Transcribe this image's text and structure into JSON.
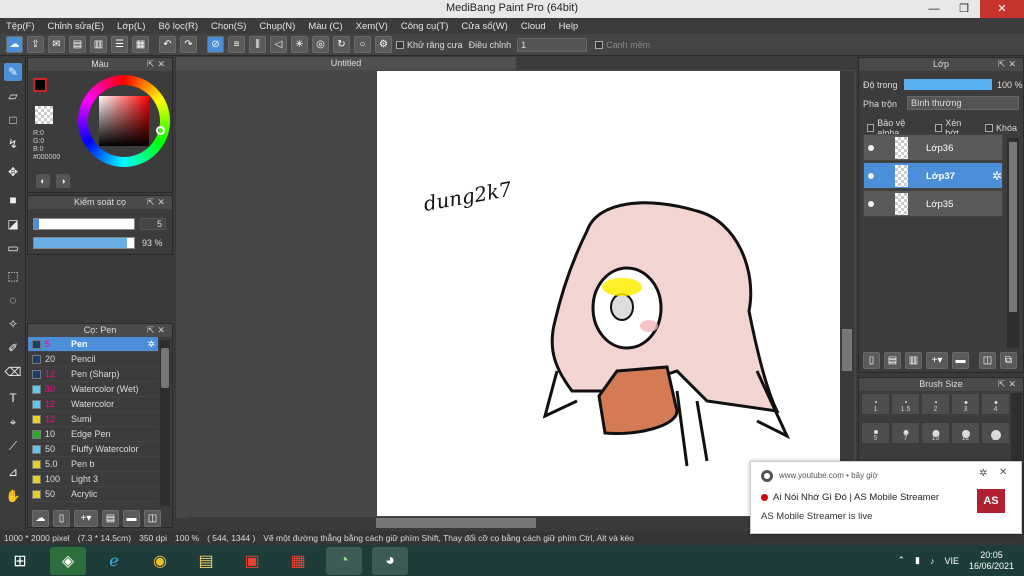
{
  "window": {
    "title": "MediBang Paint Pro (64bit)",
    "minimize": "—",
    "restore": "❐",
    "close": "✕"
  },
  "menu": [
    "Tệp(F)",
    "Chỉnh sửa(E)",
    "Lớp(L)",
    "Bộ lọc(R)",
    "Chọn(S)",
    "Chụp(N)",
    "Màu (C)",
    "Xem(V)",
    "Công cụ(T)",
    "Cửa sổ(W)",
    "Cloud",
    "Help"
  ],
  "toolbar": {
    "antialias_label": "Khử răng cưa",
    "correction_label": "Điều chỉnh",
    "correction_value": "1",
    "canvas_mem_label": "Canh mềm"
  },
  "color_panel": {
    "title": "Màu",
    "r": "R:0",
    "g": "G:0",
    "b": "B:0",
    "hex": "#000000"
  },
  "brush_control": {
    "title": "Kiểm soát cọ",
    "size": "5",
    "opacity": "93 %"
  },
  "brush_panel": {
    "title": "Cọ: Pen",
    "items": [
      {
        "size": "5",
        "name": "Pen",
        "color": "#1a3d70",
        "active": true
      },
      {
        "size": "20",
        "name": "Pencil",
        "color": "#1a3d70"
      },
      {
        "size": "12",
        "name": "Pen (Sharp)",
        "color": "#1a3d70"
      },
      {
        "size": "30",
        "name": "Watercolor (Wet)",
        "color": "#5fc8f0"
      },
      {
        "size": "12",
        "name": "Watercolor",
        "color": "#5fc8f0"
      },
      {
        "size": "12",
        "name": "Sumi",
        "color": "#e8d020"
      },
      {
        "size": "10",
        "name": "Edge Pen",
        "color": "#20b020"
      },
      {
        "size": "50",
        "name": "Fluffy Watercolor",
        "color": "#5fc8f0"
      },
      {
        "size": "5.0",
        "name": "Pen b",
        "color": "#e8d020"
      },
      {
        "size": "100",
        "name": "Light 3",
        "color": "#e8d020"
      },
      {
        "size": "50",
        "name": "Acrylic",
        "color": "#e8d020"
      }
    ]
  },
  "canvas": {
    "tab": "Untitled",
    "signature": "dung2k7"
  },
  "layer_panel": {
    "title": "Lớp",
    "opacity_label": "Độ trong",
    "opacity_value": "100 %",
    "opacity_fraction": 1.0,
    "blend_label": "Pha trộn",
    "blend_value": "Bình thường",
    "protect_alpha": "Bảo vệ alpha",
    "clipping": "Xén bớt",
    "lock": "Khóa",
    "layers": [
      {
        "name": "Lớp36",
        "active": false
      },
      {
        "name": "Lớp37",
        "active": true
      },
      {
        "name": "Lớp35",
        "active": false
      }
    ]
  },
  "brush_size_panel": {
    "title": "Brush Size",
    "sizes": [
      "1",
      "1.5",
      "2",
      "3",
      "4",
      "5",
      "7",
      "10",
      "12",
      "15"
    ]
  },
  "status": {
    "dimensions": "1000 * 2000 pixel",
    "physical": "(7.3 * 14.5cm)",
    "dpi": "350 dpi",
    "zoom": "100 %",
    "coords": "( 544, 1344 )",
    "hint": "Vẽ một đường thẳng bằng cách giữ phím Shift, Thay đổi cỡ cọ bằng cách giữ phím Ctrl, Alt và kéo"
  },
  "notification": {
    "source": "www.youtube.com",
    "time": "bây giờ",
    "title": "Ai Nói Nhớ Gì Đó | AS Mobile Streamer",
    "body": "AS Mobile Streamer is live",
    "thumb_label": "AS"
  },
  "taskbar": {
    "lang": "VIE",
    "time": "20:05",
    "date": "16/06/2021"
  },
  "colors": {
    "accent": "#4a8fd8",
    "panel": "#3c3c3c",
    "taskbar": "#1e3d3a"
  }
}
